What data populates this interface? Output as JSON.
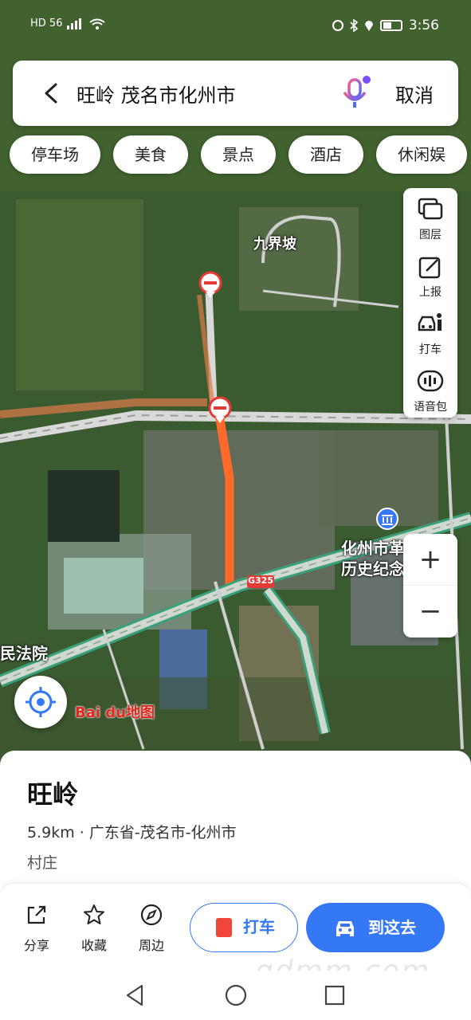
{
  "status_bar": {
    "network": "HD 56",
    "time": "3:56"
  },
  "search": {
    "query": "旺岭 茂名市化州市",
    "cancel_label": "取消"
  },
  "chips": [
    "停车场",
    "美食",
    "景点",
    "酒店",
    "休闲娱"
  ],
  "toolbar": {
    "layers_label": "图层",
    "report_label": "上报",
    "taxi_label": "打车",
    "voice_label": "语音包"
  },
  "zoom": {
    "in_label": "+",
    "out_label": "−"
  },
  "map_labels": {
    "village": "九界坡",
    "museum": "化州市革命",
    "museum_line2": "历史纪念",
    "court": "民法院",
    "road_tag": "G325",
    "baidu_logo": "Bai du地图"
  },
  "place": {
    "name": "旺岭",
    "subtitle": "5.9km · 广东省-茂名市-化州市",
    "type": "村庄"
  },
  "actions": {
    "share_label": "分享",
    "favorite_label": "收藏",
    "nearby_label": "周边",
    "taxi_label": "打车",
    "go_label": "到这去"
  },
  "watermark": "gdmm.com",
  "colors": {
    "accent": "#3478f6",
    "route": "#ff6a2b",
    "road_green": "#58d3a0"
  }
}
